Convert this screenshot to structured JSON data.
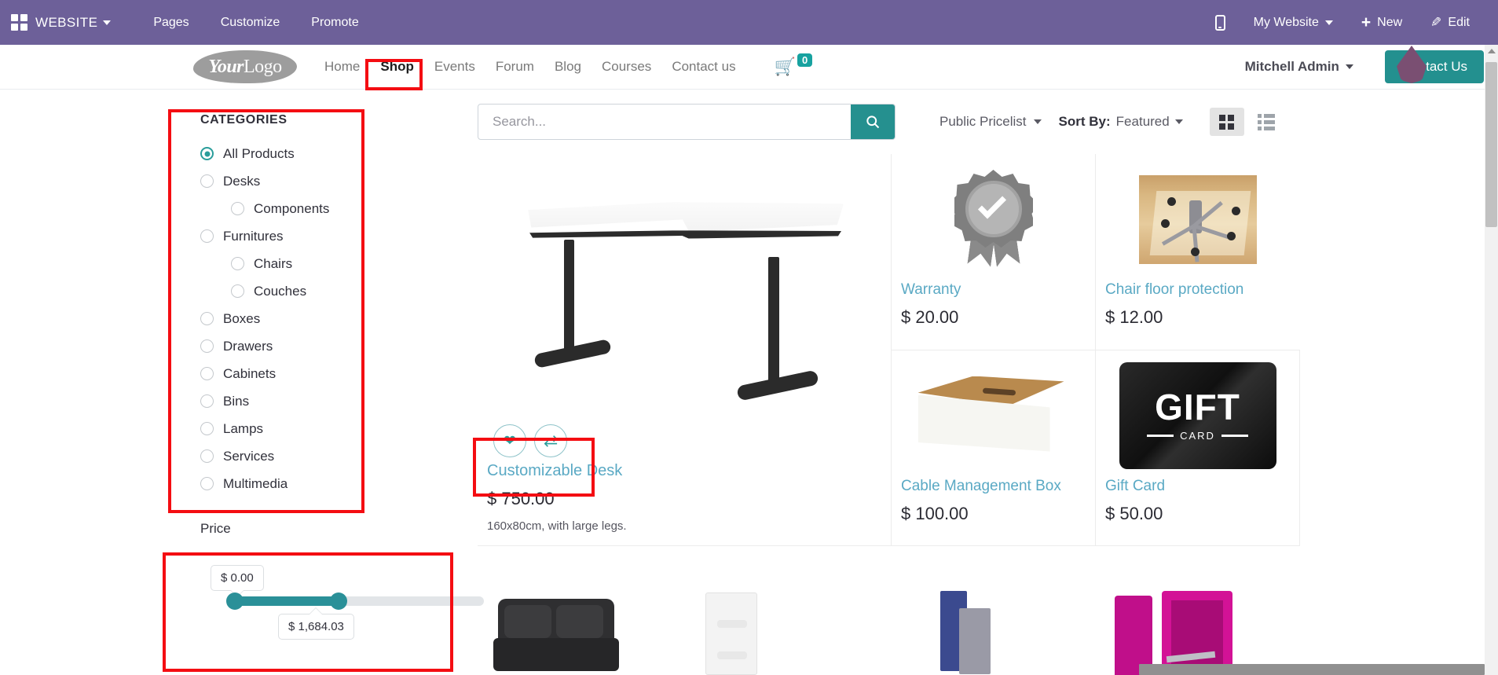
{
  "adminbar": {
    "apps_icon": "apps-grid-icon",
    "brand": "WEBSITE",
    "menu": [
      "Pages",
      "Customize",
      "Promote"
    ],
    "mobile_icon": "mobile-preview-icon",
    "site_selector": "My Website",
    "new_label": "New",
    "edit_label": "Edit",
    "background_color": "#6d6099"
  },
  "site_header": {
    "logo_part1": "Your",
    "logo_part2": "Logo",
    "nav": [
      {
        "label": "Home",
        "active": false
      },
      {
        "label": "Shop",
        "active": true
      },
      {
        "label": "Events",
        "active": false
      },
      {
        "label": "Forum",
        "active": false
      },
      {
        "label": "Blog",
        "active": false
      },
      {
        "label": "Courses",
        "active": false
      },
      {
        "label": "Contact us",
        "active": false
      }
    ],
    "cart_count": "0",
    "user": "Mitchell Admin",
    "contact_button": "Contact Us",
    "accent_color": "#23908f"
  },
  "sidebar": {
    "categories_title": "CATEGORIES",
    "categories": [
      {
        "label": "All Products",
        "selected": true,
        "indent": false
      },
      {
        "label": "Desks",
        "selected": false,
        "indent": false
      },
      {
        "label": "Components",
        "selected": false,
        "indent": true
      },
      {
        "label": "Furnitures",
        "selected": false,
        "indent": false
      },
      {
        "label": "Chairs",
        "selected": false,
        "indent": true
      },
      {
        "label": "Couches",
        "selected": false,
        "indent": true
      },
      {
        "label": "Boxes",
        "selected": false,
        "indent": false
      },
      {
        "label": "Drawers",
        "selected": false,
        "indent": false
      },
      {
        "label": "Cabinets",
        "selected": false,
        "indent": false
      },
      {
        "label": "Bins",
        "selected": false,
        "indent": false
      },
      {
        "label": "Lamps",
        "selected": false,
        "indent": false
      },
      {
        "label": "Services",
        "selected": false,
        "indent": false
      },
      {
        "label": "Multimedia",
        "selected": false,
        "indent": false
      }
    ],
    "price_title": "Price",
    "price_min_label": "$ 0.00",
    "price_max_label": "$ 1,684.03",
    "slider_color": "#2a9098"
  },
  "toolbar": {
    "search_placeholder": "Search...",
    "search_value": "",
    "search_icon": "search-icon",
    "pricelist": "Public Pricelist",
    "sort_prefix": "Sort By:",
    "sort_value": "Featured",
    "grid_view_icon": "grid-view-icon",
    "list_view_icon": "list-view-icon",
    "grid_view_active": true
  },
  "products": {
    "featured": {
      "name": "Customizable Desk",
      "price": "$ 750.00",
      "description": "160x80cm, with large legs.",
      "wishlist_icon": "heart-icon",
      "compare_icon": "compare-icon",
      "image": "white-corner-desk"
    },
    "items": [
      {
        "name": "Warranty",
        "price": "$ 20.00",
        "image": "warranty-badge"
      },
      {
        "name": "Chair floor protection",
        "price": "$ 12.00",
        "image": "chair-floor-mat"
      },
      {
        "name": "Cable Management Box",
        "price": "$ 100.00",
        "image": "cable-box"
      },
      {
        "name": "Gift Card",
        "price": "$ 50.00",
        "image": "gift-card",
        "card_title": "GIFT",
        "card_sub": "CARD"
      }
    ],
    "bottom_row": [
      {
        "image": "black-couch"
      },
      {
        "image": "white-drawer"
      },
      {
        "image": "blue-grey-panels"
      },
      {
        "image": "magenta-wardrobe"
      }
    ]
  },
  "annotations": {
    "color": "#f40d12",
    "boxes": [
      "shop-nav-item",
      "categories-panel",
      "price-slider-panel",
      "product-actions"
    ]
  }
}
